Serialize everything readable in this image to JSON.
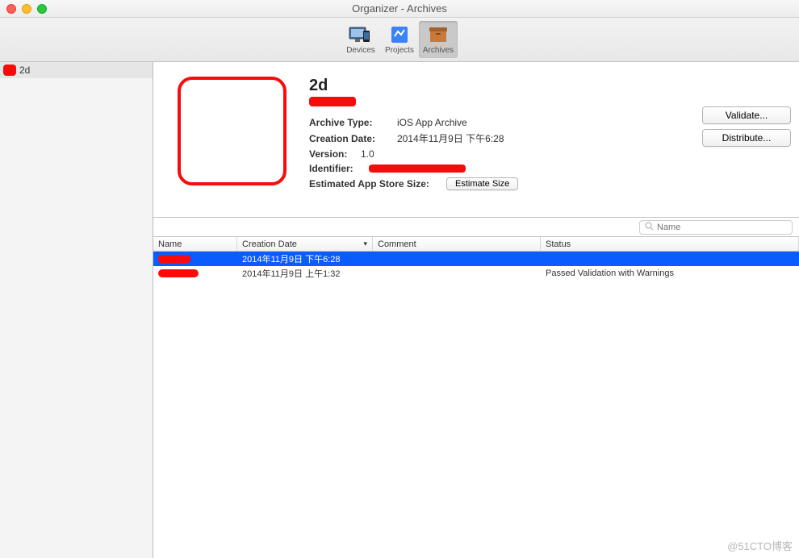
{
  "window": {
    "title": "Organizer - Archives"
  },
  "toolbar": {
    "items": [
      {
        "label": "Devices"
      },
      {
        "label": "Projects"
      },
      {
        "label": "Archives"
      }
    ],
    "selectedIndex": 2
  },
  "sidebar": {
    "items": [
      {
        "label": "2d"
      }
    ]
  },
  "detail": {
    "title": "2d",
    "archiveTypeLabel": "Archive Type:",
    "archiveType": "iOS App Archive",
    "creationDateLabel": "Creation Date:",
    "creationDate": "2014年11月9日 下午6:28",
    "versionLabel": "Version:",
    "version": "1.0",
    "identifierLabel": "Identifier:",
    "estSizeLabel": "Estimated App Store Size:",
    "estimateButton": "Estimate Size",
    "validateButton": "Validate...",
    "distributeButton": "Distribute..."
  },
  "search": {
    "placeholder": "Name"
  },
  "table": {
    "columns": {
      "name": "Name",
      "creationDate": "Creation Date",
      "comment": "Comment",
      "status": "Status"
    },
    "rows": [
      {
        "date": "2014年11月9日 下午6:28",
        "status": "",
        "selected": true
      },
      {
        "date": "2014年11月9日 上午1:32",
        "status": "Passed Validation with Warnings",
        "selected": false
      }
    ]
  },
  "watermark": "@51CTO博客"
}
